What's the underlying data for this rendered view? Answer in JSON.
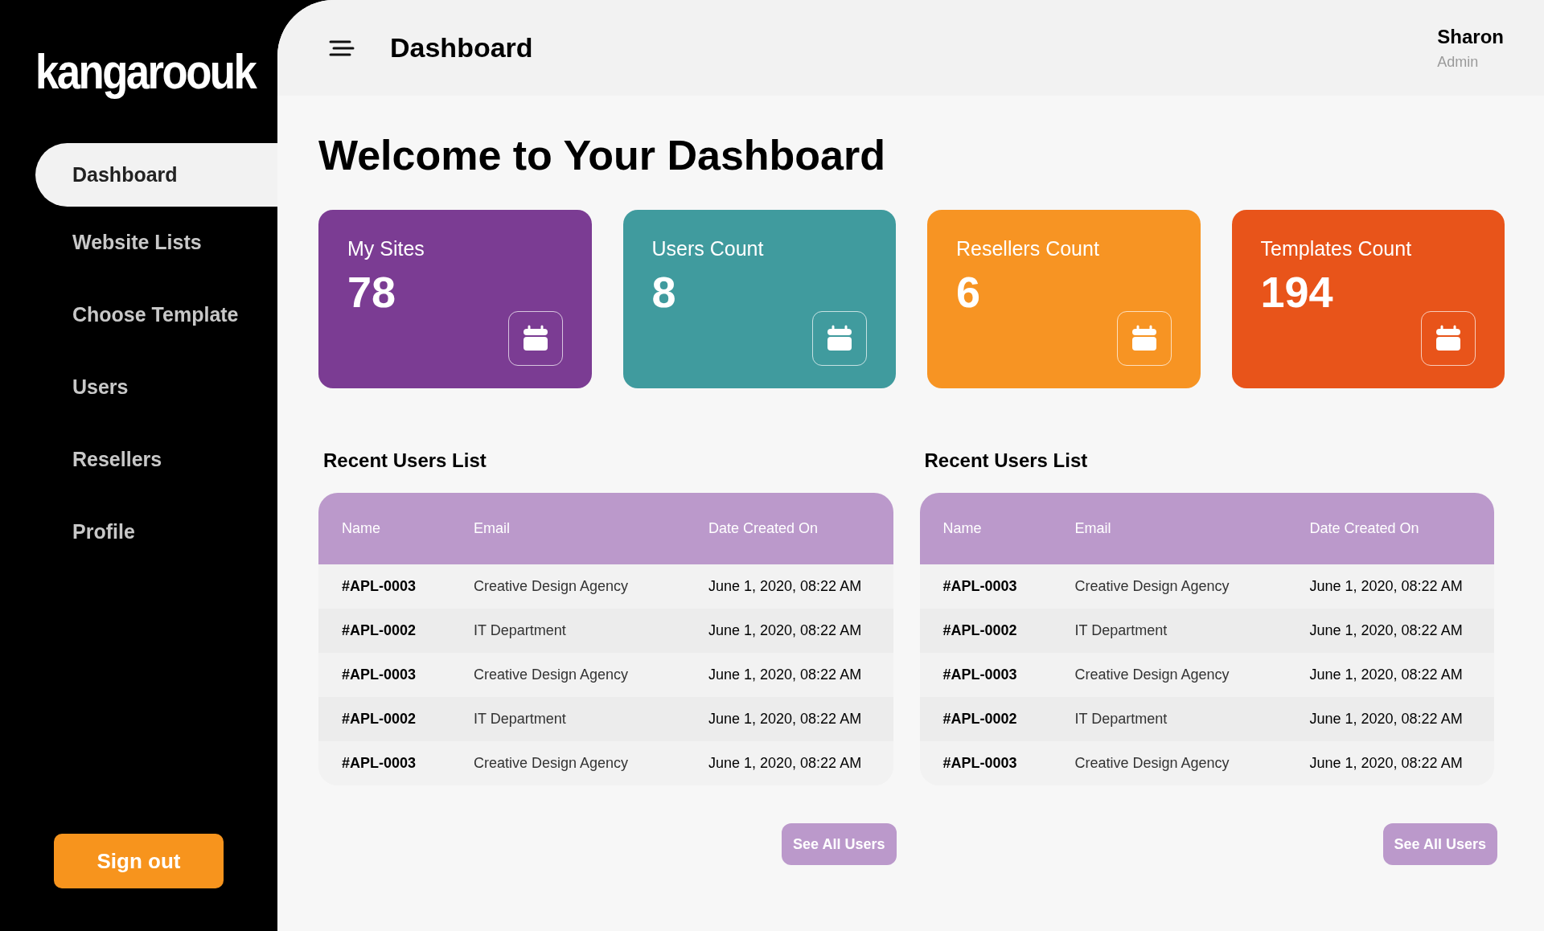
{
  "sidebar": {
    "logo": "kangaroouk",
    "items": [
      {
        "label": "Dashboard",
        "selected": true
      },
      {
        "label": "Website Lists",
        "selected": false
      },
      {
        "label": "Choose Template",
        "selected": false
      },
      {
        "label": "Users",
        "selected": false
      },
      {
        "label": "Resellers",
        "selected": false
      },
      {
        "label": "Profile",
        "selected": false
      }
    ],
    "sign_out": "Sign out"
  },
  "header": {
    "title": "Dashboard",
    "user": {
      "name": "Sharon",
      "role": "Admin"
    }
  },
  "welcome": "Welcome to Your Dashboard",
  "cards": [
    {
      "label": "My Sites",
      "value": "78",
      "color": "#7b3c93"
    },
    {
      "label": "Users Count",
      "value": "8",
      "color": "#409b9e"
    },
    {
      "label": "Resellers Count",
      "value": "6",
      "color": "#f79423"
    },
    {
      "label": "Templates Count",
      "value": "194",
      "color": "#e8541a"
    }
  ],
  "tables": [
    {
      "title": "Recent Users List",
      "columns": [
        "Name",
        "Email",
        "Date Created On"
      ],
      "rows": [
        [
          "#APL-0003",
          "Creative Design Agency",
          "June 1, 2020, 08:22 AM"
        ],
        [
          "#APL-0002",
          "IT Department",
          "June 1, 2020, 08:22 AM"
        ],
        [
          "#APL-0003",
          "Creative Design Agency",
          "June 1, 2020, 08:22 AM"
        ],
        [
          "#APL-0002",
          "IT Department",
          "June 1, 2020, 08:22 AM"
        ],
        [
          "#APL-0003",
          "Creative Design Agency",
          "June 1, 2020, 08:22 AM"
        ]
      ],
      "button": "See All Users"
    },
    {
      "title": "Recent Users List",
      "columns": [
        "Name",
        "Email",
        "Date Created On"
      ],
      "rows": [
        [
          "#APL-0003",
          "Creative Design Agency",
          "June 1, 2020, 08:22 AM"
        ],
        [
          "#APL-0002",
          "IT Department",
          "June 1, 2020, 08:22 AM"
        ],
        [
          "#APL-0003",
          "Creative Design Agency",
          "June 1, 2020, 08:22 AM"
        ],
        [
          "#APL-0002",
          "IT Department",
          "June 1, 2020, 08:22 AM"
        ],
        [
          "#APL-0003",
          "Creative Design Agency",
          "June 1, 2020, 08:22 AM"
        ]
      ],
      "button": "See All Users"
    }
  ]
}
